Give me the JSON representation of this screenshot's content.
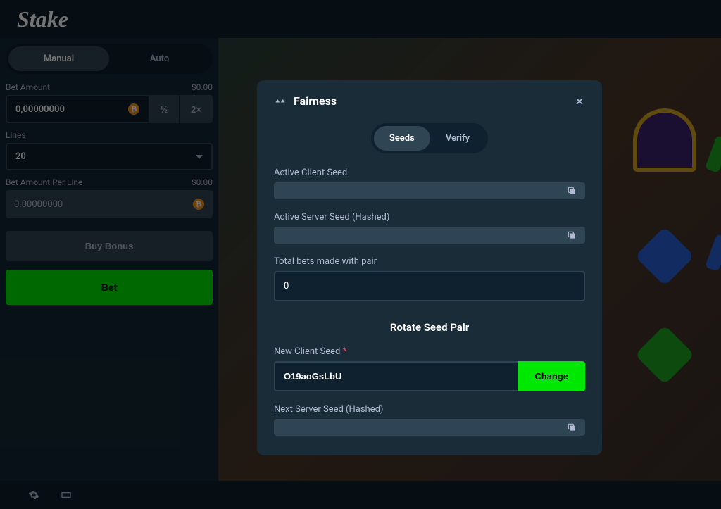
{
  "brand": "Stake",
  "sidebar": {
    "modes": {
      "manual": "Manual",
      "auto": "Auto"
    },
    "bet_amount_label": "Bet Amount",
    "bet_amount_usd": "$0.00",
    "bet_amount_value": "0,00000000",
    "half_label": "½",
    "double_label": "2×",
    "lines_label": "Lines",
    "lines_value": "20",
    "bet_per_line_label": "Bet Amount Per Line",
    "bet_per_line_usd": "$0.00",
    "bet_per_line_value": "0.00000000",
    "buy_bonus_label": "Buy Bonus",
    "bet_label": "Bet"
  },
  "modal": {
    "title": "Fairness",
    "tabs": {
      "seeds": "Seeds",
      "verify": "Verify"
    },
    "active_client_label": "Active Client Seed",
    "active_client_value": "",
    "active_server_label": "Active Server Seed (Hashed)",
    "active_server_value": "",
    "total_bets_label": "Total bets made with pair",
    "total_bets_value": "0",
    "rotate_title": "Rotate Seed Pair",
    "new_client_label": "New Client Seed",
    "new_client_value": "O19aoGsLbU",
    "change_label": "Change",
    "next_server_label": "Next Server Seed (Hashed)",
    "next_server_value": ""
  }
}
